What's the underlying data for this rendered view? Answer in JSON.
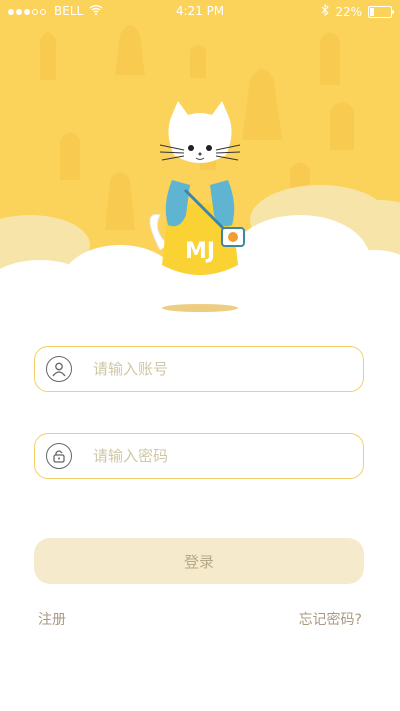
{
  "status_bar": {
    "carrier": "BELL",
    "time": "4:21 PM",
    "battery": "22%",
    "battery_level": 0.22,
    "signal_bars": 3,
    "signal_total": 5,
    "icons": [
      "wifi-icon",
      "bluetooth-icon",
      "battery-icon"
    ]
  },
  "hero": {
    "mascot_shirt_text": "MJ",
    "colors": {
      "background": "#fbd25a",
      "cloud": "#ffffff",
      "cat_shirt": "#fbd233",
      "cat_scarf": "#5fb4d2"
    }
  },
  "form": {
    "username": {
      "placeholder": "请输入账号",
      "value": "",
      "icon": "user-icon"
    },
    "password": {
      "placeholder": "请输入密码",
      "value": "",
      "icon": "lock-icon"
    },
    "login_label": "登录",
    "register_label": "注册",
    "forgot_label": "忘记密码?"
  },
  "colors": {
    "field_border": "#f3cf66",
    "login_button_bg": "#f5ebcc",
    "link_text": "#a99a82",
    "placeholder": "#cfc7a5"
  }
}
